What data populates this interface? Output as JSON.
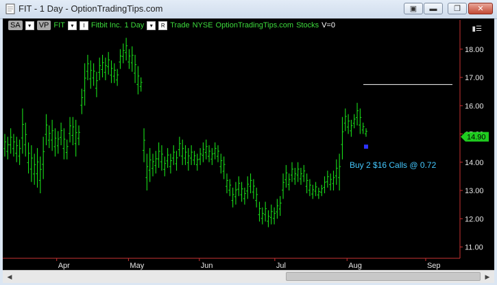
{
  "window": {
    "title": "FIT - 1 Day - OptionTradingTips.com",
    "buttons": [
      "pin-icon",
      "minimize-icon",
      "restore-icon",
      "close-icon"
    ]
  },
  "toolbar": {
    "sa": "SA",
    "vp": "VP",
    "symbol": "FIT",
    "company": "Fitbit Inc.",
    "interval": "1 Day",
    "mode": "Trade",
    "exchange": "NYSE",
    "source": "OptionTradingTips.com",
    "type": "Stocks",
    "volume": "V=0"
  },
  "colors": {
    "bars": "#19e019",
    "axis": "#cc3333",
    "price_tag": "#1fcc1f",
    "annotation": "#44c8ff",
    "marker": "#2d33ff"
  },
  "annotation": {
    "text": "Buy 2 $16 Calls @ 0.72"
  },
  "chart_data": {
    "type": "ohlc",
    "title": "",
    "xlabel": "",
    "ylabel": "",
    "ylim": [
      10.6,
      18.6
    ],
    "yticks": [
      11.0,
      12.0,
      13.0,
      14.0,
      15.0,
      16.0,
      17.0,
      18.0
    ],
    "ytick_labels": [
      "11.00",
      "12.00",
      "13.00",
      "14.00",
      "15.00",
      "16.00",
      "17.00",
      "18.00"
    ],
    "xtick_labels": [
      "Apr",
      "May",
      "Jun",
      "Jul",
      "Aug",
      "Sep"
    ],
    "last_price": "14.90",
    "reference_line": 16.75,
    "bars": [
      {
        "h": 15.0,
        "l": 14.2
      },
      {
        "h": 14.9,
        "l": 14.1
      },
      {
        "h": 15.2,
        "l": 14.3
      },
      {
        "h": 15.0,
        "l": 14.2
      },
      {
        "h": 14.9,
        "l": 14.0
      },
      {
        "h": 14.8,
        "l": 13.9
      },
      {
        "h": 15.9,
        "l": 14.3
      },
      {
        "h": 15.4,
        "l": 14.2
      },
      {
        "h": 14.7,
        "l": 13.6
      },
      {
        "h": 14.6,
        "l": 13.3
      },
      {
        "h": 14.3,
        "l": 13.2
      },
      {
        "h": 14.5,
        "l": 13.1
      },
      {
        "h": 14.2,
        "l": 12.9
      },
      {
        "h": 14.9,
        "l": 13.4
      },
      {
        "h": 15.7,
        "l": 14.6
      },
      {
        "h": 15.3,
        "l": 14.5
      },
      {
        "h": 15.5,
        "l": 14.4
      },
      {
        "h": 15.2,
        "l": 14.2
      },
      {
        "h": 15.1,
        "l": 14.3
      },
      {
        "h": 15.4,
        "l": 14.6
      },
      {
        "h": 15.2,
        "l": 14.1
      },
      {
        "h": 14.8,
        "l": 14.1
      },
      {
        "h": 15.6,
        "l": 14.7
      },
      {
        "h": 15.6,
        "l": 14.6
      },
      {
        "h": 15.5,
        "l": 14.2
      },
      {
        "h": 15.3,
        "l": 14.6
      },
      {
        "h": 16.6,
        "l": 15.7
      },
      {
        "h": 17.5,
        "l": 16.0
      },
      {
        "h": 17.8,
        "l": 16.9
      },
      {
        "h": 17.6,
        "l": 16.6
      },
      {
        "h": 17.5,
        "l": 16.7
      },
      {
        "h": 17.2,
        "l": 16.3
      },
      {
        "h": 17.7,
        "l": 16.9
      },
      {
        "h": 17.8,
        "l": 17.0
      },
      {
        "h": 17.7,
        "l": 16.9
      },
      {
        "h": 17.9,
        "l": 17.1
      },
      {
        "h": 17.6,
        "l": 16.8
      },
      {
        "h": 17.5,
        "l": 16.8
      },
      {
        "h": 17.3,
        "l": 16.7
      },
      {
        "h": 18.0,
        "l": 17.3
      },
      {
        "h": 18.2,
        "l": 17.5
      },
      {
        "h": 18.4,
        "l": 17.6
      },
      {
        "h": 18.0,
        "l": 17.3
      },
      {
        "h": 18.1,
        "l": 17.2
      },
      {
        "h": 17.8,
        "l": 16.8
      },
      {
        "h": 17.4,
        "l": 16.4
      },
      {
        "h": 17.0,
        "l": 16.5
      },
      {
        "h": 15.2,
        "l": 14.0
      },
      {
        "h": 14.3,
        "l": 13.0
      },
      {
        "h": 14.5,
        "l": 13.3
      },
      {
        "h": 14.3,
        "l": 13.5
      },
      {
        "h": 14.4,
        "l": 13.6
      },
      {
        "h": 14.7,
        "l": 13.8
      },
      {
        "h": 14.6,
        "l": 13.7
      },
      {
        "h": 14.2,
        "l": 13.5
      },
      {
        "h": 14.5,
        "l": 13.8
      },
      {
        "h": 14.3,
        "l": 13.6
      },
      {
        "h": 14.6,
        "l": 13.9
      },
      {
        "h": 14.4,
        "l": 13.7
      },
      {
        "h": 14.9,
        "l": 14.2
      },
      {
        "h": 14.8,
        "l": 13.9
      },
      {
        "h": 14.6,
        "l": 13.9
      },
      {
        "h": 14.5,
        "l": 13.7
      },
      {
        "h": 14.6,
        "l": 13.9
      },
      {
        "h": 14.4,
        "l": 13.9
      },
      {
        "h": 14.3,
        "l": 13.7
      },
      {
        "h": 14.5,
        "l": 13.9
      },
      {
        "h": 14.7,
        "l": 14.0
      },
      {
        "h": 14.8,
        "l": 14.1
      },
      {
        "h": 14.6,
        "l": 14.0
      },
      {
        "h": 14.5,
        "l": 13.9
      },
      {
        "h": 14.7,
        "l": 14.1
      },
      {
        "h": 14.6,
        "l": 14.0
      },
      {
        "h": 14.3,
        "l": 13.6
      },
      {
        "h": 14.2,
        "l": 13.4
      },
      {
        "h": 13.6,
        "l": 12.9
      },
      {
        "h": 13.4,
        "l": 12.8
      },
      {
        "h": 13.1,
        "l": 12.4
      },
      {
        "h": 13.3,
        "l": 12.5
      },
      {
        "h": 13.5,
        "l": 12.8
      },
      {
        "h": 13.3,
        "l": 12.6
      },
      {
        "h": 13.1,
        "l": 12.5
      },
      {
        "h": 13.5,
        "l": 12.7
      },
      {
        "h": 13.6,
        "l": 12.9
      },
      {
        "h": 13.4,
        "l": 12.7
      },
      {
        "h": 13.1,
        "l": 12.4
      },
      {
        "h": 12.6,
        "l": 11.9
      },
      {
        "h": 12.4,
        "l": 11.8
      },
      {
        "h": 12.6,
        "l": 11.9
      },
      {
        "h": 12.3,
        "l": 11.7
      },
      {
        "h": 12.5,
        "l": 11.8
      },
      {
        "h": 12.4,
        "l": 11.8
      },
      {
        "h": 12.7,
        "l": 12.0
      },
      {
        "h": 12.8,
        "l": 12.1
      },
      {
        "h": 13.6,
        "l": 12.7
      },
      {
        "h": 13.9,
        "l": 13.1
      },
      {
        "h": 13.6,
        "l": 13.0
      },
      {
        "h": 14.0,
        "l": 13.3
      },
      {
        "h": 13.8,
        "l": 13.2
      },
      {
        "h": 14.0,
        "l": 13.3
      },
      {
        "h": 13.8,
        "l": 13.2
      },
      {
        "h": 13.9,
        "l": 13.3
      },
      {
        "h": 13.6,
        "l": 12.9
      },
      {
        "h": 13.4,
        "l": 12.8
      },
      {
        "h": 13.2,
        "l": 12.7
      },
      {
        "h": 13.3,
        "l": 12.8
      },
      {
        "h": 13.1,
        "l": 12.7
      },
      {
        "h": 13.2,
        "l": 12.8
      },
      {
        "h": 13.5,
        "l": 12.9
      },
      {
        "h": 13.7,
        "l": 13.1
      },
      {
        "h": 13.6,
        "l": 13.0
      },
      {
        "h": 13.7,
        "l": 13.0
      },
      {
        "h": 14.1,
        "l": 13.2
      },
      {
        "h": 14.3,
        "l": 13.0
      },
      {
        "h": 15.6,
        "l": 14.1
      },
      {
        "h": 15.9,
        "l": 15.1
      },
      {
        "h": 15.7,
        "l": 15.0
      },
      {
        "h": 15.5,
        "l": 14.9
      },
      {
        "h": 15.7,
        "l": 15.2
      },
      {
        "h": 16.1,
        "l": 15.3
      },
      {
        "h": 15.9,
        "l": 15.0
      },
      {
        "h": 15.4,
        "l": 15.0
      },
      {
        "h": 15.2,
        "l": 14.9
      }
    ]
  }
}
